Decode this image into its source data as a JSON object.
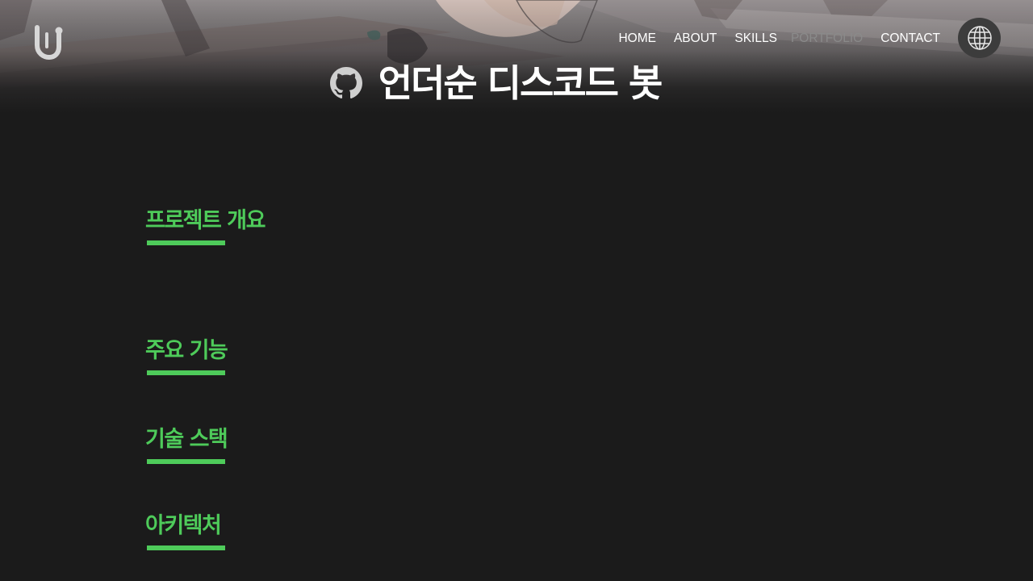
{
  "header": {
    "nav": {
      "home": "HOME",
      "about": "ABOUT",
      "skills": "SKILLS",
      "portfolio": "PORTFOLIO",
      "contact": "CONTACT"
    },
    "active_item": "PORTFOLIO",
    "logo_icon": "logo-icon",
    "language_icon": "globe-icon"
  },
  "project": {
    "title": "언더순 디스코드 봇",
    "repo_icon": "github-icon"
  },
  "sections": {
    "overview": "프로젝트 개요",
    "features": "주요 기능",
    "tech_stack": "기술 스택",
    "architecture": "아키텍처"
  },
  "colors": {
    "background": "#1b1b1b",
    "accent": "#4ecb5a",
    "nav_text": "#ffffff",
    "nav_active": "#8a8a8a",
    "lang_button": "#3c3c3c"
  }
}
